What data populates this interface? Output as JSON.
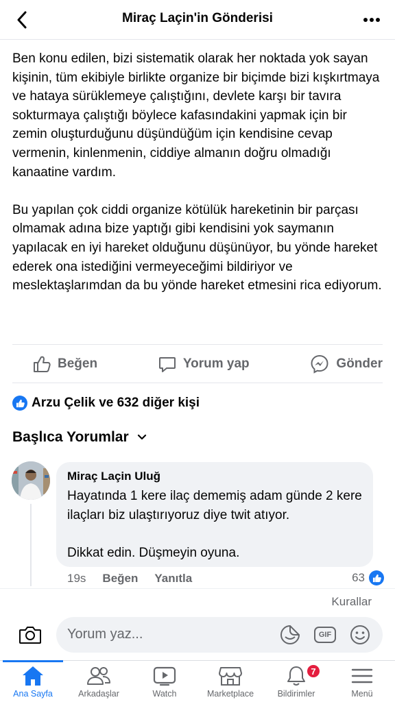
{
  "header": {
    "title": "Miraç Laçin'in Gönderisi",
    "back_icon": "chevron-left-icon",
    "more_icon": "more-horizontal-icon"
  },
  "post": {
    "paragraphs": [
      "Ben konu edilen, bizi sistematik olarak her noktada yok sayan kişinin, tüm ekibiyle birlikte organize bir biçimde bizi kışkırtmaya ve hataya sürüklemeye çalıştığını, devlete karşı bir tavıra sokturmaya çalıştığı böylece kafasındakini yapmak için bir zemin oluşturduğunu düşündüğüm için kendisine cevap vermenin, kinlenmenin, ciddiye almanın doğru olmadığı kanaatine vardım.",
      "Bu yapılan çok ciddi organize kötülük hareketinin bir parçası olmamak adına bize yaptığı gibi kendisini yok saymanın yapılacak en iyi hareket olduğunu düşünüyor, bu yönde hareket ederek ona istediğini vermeyeceğimi bildiriyor ve meslektaşlarımdan da bu yönde hareket etmesini rica ediyorum."
    ]
  },
  "actions": {
    "like_label": "Beğen",
    "comment_label": "Yorum yap",
    "share_label": "Gönder"
  },
  "reactions": {
    "summary": "Arzu Çelik ve 632 diğer kişi"
  },
  "comments_section": {
    "title": "Başlıca Yorumlar"
  },
  "comment": {
    "author": "Miraç Laçin Uluğ",
    "paragraphs": [
      "Hayatında 1 kere ilaç dememiş adam günde 2 kere ilaçları biz ulaştırıyoruz diye twit atıyor.",
      "Dikkat edin. Düşmeyin oyuna."
    ],
    "time": "19s",
    "like_label": "Beğen",
    "reply_label": "Yanıtla",
    "like_count": "63"
  },
  "composer": {
    "rules_label": "Kurallar",
    "placeholder": "Yorum yaz...",
    "gif_label": "GIF"
  },
  "tabbar": {
    "tabs": [
      {
        "label": "Ana Sayfa",
        "icon": "home-icon",
        "active": true
      },
      {
        "label": "Arkadaşlar",
        "icon": "friends-icon"
      },
      {
        "label": "Watch",
        "icon": "watch-icon"
      },
      {
        "label": "Marketplace",
        "icon": "marketplace-icon"
      },
      {
        "label": "Bildirimler",
        "icon": "bell-icon",
        "badge": "7"
      },
      {
        "label": "Menü",
        "icon": "menu-icon"
      }
    ]
  },
  "colors": {
    "accent": "#1877f2",
    "secondary_text": "#65676b",
    "bubble_bg": "#f0f2f5",
    "badge": "#e41e3f"
  }
}
